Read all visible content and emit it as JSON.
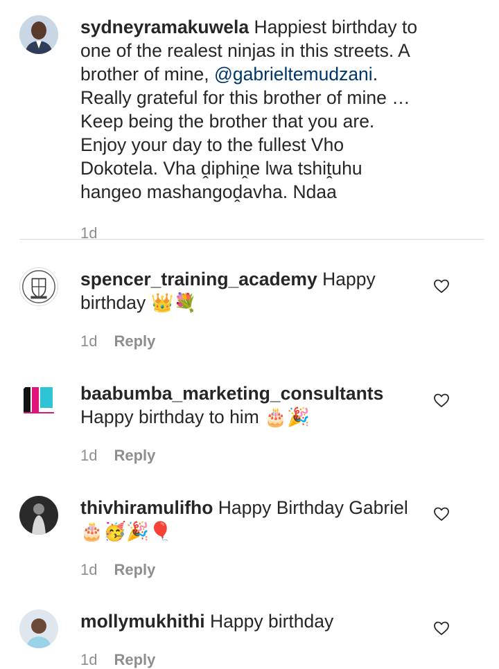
{
  "caption": {
    "username": "sydneyramakuwela",
    "text_part1": "Happiest birthday to one of the realest ninjas in this streets. A brother of mine,",
    "mention": "@gabrieltemudzani",
    "text_part2": ". Really grateful for this brother of mine … Keep being the brother that you are. Enjoy your day to the fullest Vho Dokotela. Vha ḓiphiṋe lwa tshiṱuhu hangeo mashangoḓavha. Ndaa",
    "time": "1d"
  },
  "comments": [
    {
      "username": "spencer_training_academy",
      "text": "Happy birthday 👑💐",
      "time": "1d",
      "reply_label": "Reply",
      "avatar_icon": "academy-crest-icon"
    },
    {
      "username": "baabumba_marketing_consultants",
      "text": "Happy birthday to him 🎂🎉",
      "time": "1d",
      "reply_label": "Reply",
      "avatar_icon": "baap-logo-icon"
    },
    {
      "username": "thivhiramulifho",
      "text": "Happy Birthday Gabriel 🎂🥳🎉🎈",
      "time": "1d",
      "reply_label": "Reply",
      "avatar_icon": "person-photo-icon"
    },
    {
      "username": "mollymukhithi",
      "text": "Happy birthday",
      "time": "1d",
      "reply_label": "Reply",
      "avatar_icon": "person-photo-icon"
    }
  ],
  "colors": {
    "text": "#262626",
    "secondary": "#8e8e8e",
    "mention": "#00376b",
    "divider": "#dbdbdb"
  }
}
